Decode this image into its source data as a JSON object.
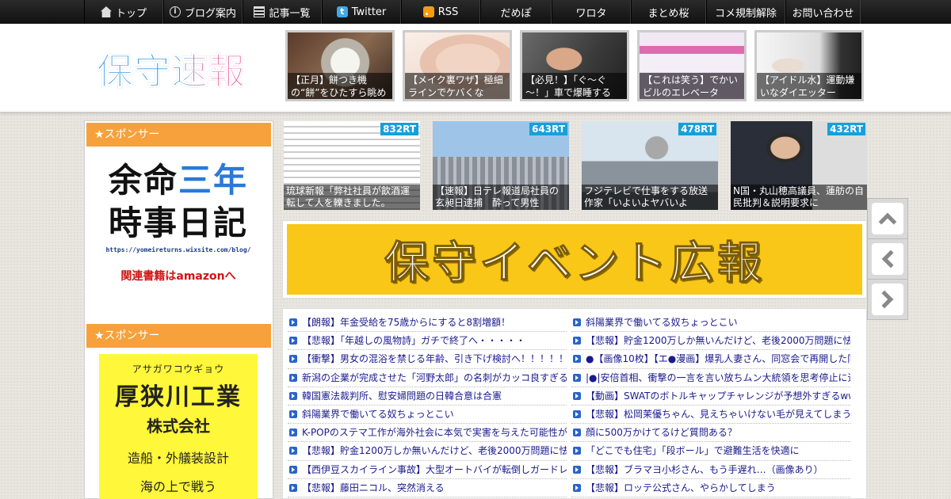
{
  "nav": {
    "items": [
      {
        "label": "トップ",
        "icon": "home-icon"
      },
      {
        "label": "ブログ案内",
        "icon": "info-icon"
      },
      {
        "label": "記事一覧",
        "icon": "list-icon"
      },
      {
        "label": "Twitter",
        "icon": "twitter-icon"
      },
      {
        "label": "RSS",
        "icon": "rss-icon"
      },
      {
        "label": "だめぽ"
      },
      {
        "label": "ワロタ"
      },
      {
        "label": "まとめ桜"
      },
      {
        "label": "コメ規制解除"
      },
      {
        "label": "お問い合わせ"
      }
    ]
  },
  "header": {
    "logo": "保守速報",
    "thumbs": [
      {
        "caption": "【正月】餅つき機の“餅”をひたすら眺め"
      },
      {
        "caption": "【メイク裏ワザ】極細ラインでケバくな"
      },
      {
        "caption": "【必見！】「ぐ～ぐ～！」車で爆睡する"
      },
      {
        "caption": "【これは笑う】でかいビルのエレベータ"
      },
      {
        "caption": "【アイドル水】運動嫌いなダイエッター"
      }
    ]
  },
  "sidebar": {
    "sponsor_label": "★スポンサー",
    "ad1": {
      "line1a": "余命",
      "line1b": "三年",
      "line2": "時事日記",
      "url": "https://yomeireturns.wixsite.com/blog/",
      "amazon": "関連書籍はamazonへ"
    },
    "ad2": {
      "kana": "アサガワコウギョウ",
      "name": "厚狭川工業",
      "company": "株式会社",
      "business": "造船・外艤装設計",
      "cut": "海の上で戦う"
    }
  },
  "ranking": [
    {
      "rt": "832RT",
      "caption": "琉球新報「弊社社員が飲酒運転して人を轢きました。"
    },
    {
      "rt": "643RT",
      "caption": "【速報】日テレ報道局社員の玄昶日逮捕　酔って男性"
    },
    {
      "rt": "478RT",
      "caption": "フジテレビで仕事をする放送作家「いよいよヤバいよ"
    },
    {
      "rt": "432RT",
      "caption": "N国・丸山穂高議員、蓮舫の自民批判＆説明要求に"
    }
  ],
  "banner": {
    "text": "保守イベント広報"
  },
  "articles": {
    "left": [
      "【朗報】年金受給を75歳からにすると8割増額！",
      "【悲報】「年越しの風物詩」ガチで終了へ・・・・・",
      "【衝撃】男女の混浴を禁じる年齢、引き下げ検討へ！！！！！",
      "新潟の企業が完成させた「河野太郎」の名刺がカッコ良すぎる",
      "韓国憲法裁判所、慰安婦問題の日韓合意は合憲",
      "斜陽業界で働いてる奴ちょっとこい",
      "K-POPのステマ工作が海外社会に本気で実害を与えた可能性が",
      "【悲報】貯金1200万しか無いんだけど、老後2000万問題に怯え",
      "【西伊豆スカイライン事故】大型オートバイが転倒しガードレ",
      "【悲報】藤田ニコル、突然消える"
    ],
    "right": [
      "斜陽業界で働いてる奴ちょっとこい",
      "【悲報】貯金1200万しか無いんだけど、老後2000万問題に怯え",
      "●【画像10枚】【エ●漫画】爆乳人妻さん、同窓会で再開した同",
      "|●|安倍首相、衝撃の一言を言い放ちムン大統領を思考停止に追",
      "【動画】SWATのボトルキャップチャレンジが予想外すぎるww",
      "【悲報】松岡茉優ちゃん、見えちゃいけない毛が見えてしまう",
      "顔に500万かけてるけど質問ある？",
      "「どこでも住宅」「段ボール」で避難生活を快適に",
      "【悲報】ブラマヨ小杉さん、もう手遅れ…（画像あり）",
      "【悲報】ロッテ公式さん、やらかしてしまう"
    ]
  }
}
